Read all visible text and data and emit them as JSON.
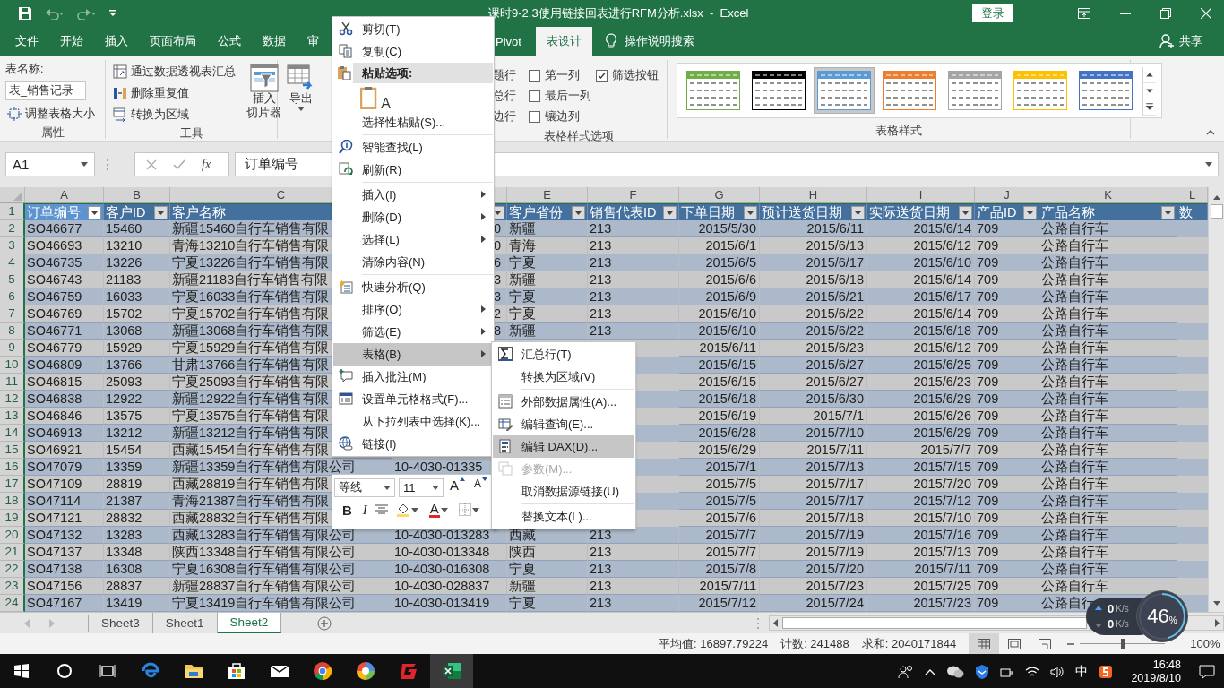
{
  "title_bar": {
    "title": "课时9-2.3使用链接回表进行RFM分析.xlsx  -  Excel",
    "sign_in": "登录"
  },
  "ribbon_tabs": [
    {
      "label": "文件",
      "selected": false
    },
    {
      "label": "开始",
      "selected": false
    },
    {
      "label": "插入",
      "selected": false
    },
    {
      "label": "页面布局",
      "selected": false
    },
    {
      "label": "公式",
      "selected": false
    },
    {
      "label": "数据",
      "selected": false
    },
    {
      "label": "审",
      "selected": false
    },
    {
      "label": "Pivot",
      "selected": false
    },
    {
      "label": "表设计",
      "selected": true
    }
  ],
  "tell_me": "操作说明搜索",
  "share": "共享",
  "ribbon": {
    "properties": {
      "name_label": "表名称:",
      "table_name": "表_销售记录",
      "resize": "调整表格大小",
      "label": "属性"
    },
    "tools": {
      "buttons": [
        "通过数据透视表汇总",
        "删除重复值",
        "转换为区域"
      ],
      "slicer": [
        "插入",
        "切片器"
      ],
      "label": "工具"
    },
    "export": "导出",
    "style_options": {
      "covered_labels": [
        "题行",
        "总行",
        "边行"
      ],
      "checkboxes": [
        {
          "label": "第一列",
          "checked": false
        },
        {
          "label": "最后一列",
          "checked": false
        },
        {
          "label": "镶边列",
          "checked": false
        },
        {
          "label": "筛选按钮",
          "checked": true
        }
      ],
      "label": "表格样式选项"
    },
    "table_styles": {
      "swatches": [
        {
          "color": "#70ad47",
          "selected": false
        },
        {
          "color": "#000000",
          "selected": false
        },
        {
          "color": "#5b9bd5",
          "selected": true
        },
        {
          "color": "#ed7d31",
          "selected": false
        },
        {
          "color": "#a5a5a5",
          "selected": false
        },
        {
          "color": "#ffc000",
          "selected": false
        },
        {
          "color": "#4472c4",
          "selected": false
        }
      ],
      "label": "表格样式"
    }
  },
  "formula_bar": {
    "name_box": "A1",
    "function_label": "fx",
    "formula": "订单编号"
  },
  "sheet": {
    "columns": [
      {
        "letter": "A",
        "header": "订单编号",
        "active": true
      },
      {
        "letter": "B",
        "header": "客户ID",
        "active": false
      },
      {
        "letter": "C",
        "header": "客户名称",
        "active": false
      },
      {
        "active": false
      },
      {
        "letter": "E",
        "header": "客户省份",
        "active": false
      },
      {
        "letter": "F",
        "header": "销售代表ID",
        "active": false
      },
      {
        "letter": "G",
        "header": "下单日期",
        "active": false
      },
      {
        "letter": "H",
        "header": "预计送货日期",
        "active": false
      },
      {
        "letter": "I",
        "header": "实际送货日期",
        "active": false
      },
      {
        "letter": "J",
        "header": "产品ID",
        "active": false
      },
      {
        "letter": "K",
        "header": "产品名称",
        "active": false
      },
      {
        "letter": "L",
        "header": "数",
        "active": false
      }
    ],
    "header_row": "1",
    "rows": [
      {
        "num": "2",
        "cells": {
          "A": "SO46677",
          "B": "15460",
          "C": "新疆15460自行车销售有限",
          "D_end": "0",
          "E": "新疆",
          "F": "213",
          "G": "2015/5/30",
          "H": "2015/6/11",
          "I": "2015/6/14",
          "J": "709",
          "K": "公路自行车"
        }
      },
      {
        "num": "3",
        "cells": {
          "A": "SO46693",
          "B": "13210",
          "C": "青海13210自行车销售有限",
          "D_end": "0",
          "E": "青海",
          "F": "213",
          "G": "2015/6/1",
          "H": "2015/6/13",
          "I": "2015/6/12",
          "J": "709",
          "K": "公路自行车"
        }
      },
      {
        "num": "4",
        "cells": {
          "A": "SO46735",
          "B": "13226",
          "C": "宁夏13226自行车销售有限",
          "D_end": "6",
          "E": "宁夏",
          "F": "213",
          "G": "2015/6/5",
          "H": "2015/6/17",
          "I": "2015/6/10",
          "J": "709",
          "K": "公路自行车"
        }
      },
      {
        "num": "5",
        "cells": {
          "A": "SO46743",
          "B": "21183",
          "C": "新疆21183自行车销售有限",
          "D_end": "3",
          "E": "新疆",
          "F": "213",
          "G": "2015/6/6",
          "H": "2015/6/18",
          "I": "2015/6/14",
          "J": "709",
          "K": "公路自行车"
        }
      },
      {
        "num": "6",
        "cells": {
          "A": "SO46759",
          "B": "16033",
          "C": "宁夏16033自行车销售有限",
          "D_end": "3",
          "E": "宁夏",
          "F": "213",
          "G": "2015/6/9",
          "H": "2015/6/21",
          "I": "2015/6/17",
          "J": "709",
          "K": "公路自行车"
        }
      },
      {
        "num": "7",
        "cells": {
          "A": "SO46769",
          "B": "15702",
          "C": "宁夏15702自行车销售有限",
          "D_end": "2",
          "E": "宁夏",
          "F": "213",
          "G": "2015/6/10",
          "H": "2015/6/22",
          "I": "2015/6/14",
          "J": "709",
          "K": "公路自行车"
        }
      },
      {
        "num": "8",
        "cells": {
          "A": "SO46771",
          "B": "13068",
          "C": "新疆13068自行车销售有限",
          "D_end": "8",
          "E": "新疆",
          "F": "213",
          "G": "2015/6/10",
          "H": "2015/6/22",
          "I": "2015/6/18",
          "J": "709",
          "K": "公路自行车"
        }
      },
      {
        "num": "9",
        "cells": {
          "A": "SO46779",
          "B": "15929",
          "C": "宁夏15929自行车销售有限",
          "G": "2015/6/11",
          "H": "2015/6/23",
          "I": "2015/6/12",
          "J": "709",
          "K": "公路自行车"
        }
      },
      {
        "num": "10",
        "cells": {
          "A": "SO46809",
          "B": "13766",
          "C": "甘肃13766自行车销售有限",
          "G": "2015/6/15",
          "H": "2015/6/27",
          "I": "2015/6/25",
          "J": "709",
          "K": "公路自行车"
        }
      },
      {
        "num": "11",
        "cells": {
          "A": "SO46815",
          "B": "25093",
          "C": "宁夏25093自行车销售有限",
          "G": "2015/6/15",
          "H": "2015/6/27",
          "I": "2015/6/23",
          "J": "709",
          "K": "公路自行车"
        }
      },
      {
        "num": "12",
        "cells": {
          "A": "SO46838",
          "B": "12922",
          "C": "新疆12922自行车销售有限",
          "G": "2015/6/18",
          "H": "2015/6/30",
          "I": "2015/6/29",
          "J": "709",
          "K": "公路自行车"
        }
      },
      {
        "num": "13",
        "cells": {
          "A": "SO46846",
          "B": "13575",
          "C": "宁夏13575自行车销售有限",
          "G": "2015/6/19",
          "H": "2015/7/1",
          "I": "2015/6/26",
          "J": "709",
          "K": "公路自行车"
        }
      },
      {
        "num": "14",
        "cells": {
          "A": "SO46913",
          "B": "13212",
          "C": "新疆13212自行车销售有限",
          "G": "2015/6/28",
          "H": "2015/7/10",
          "I": "2015/6/29",
          "J": "709",
          "K": "公路自行车"
        }
      },
      {
        "num": "15",
        "cells": {
          "A": "SO46921",
          "B": "15454",
          "C": "西藏15454自行车销售有限",
          "G": "2015/6/29",
          "H": "2015/7/11",
          "I": "2015/7/7",
          "J": "709",
          "K": "公路自行车"
        }
      },
      {
        "num": "16",
        "cells": {
          "A": "SO47079",
          "B": "13359",
          "C": "新疆13359自行车销售有限公司",
          "D": "10-4030-01335",
          "G": "2015/7/1",
          "H": "2015/7/13",
          "I": "2015/7/15",
          "J": "709",
          "K": "公路自行车"
        }
      },
      {
        "num": "17",
        "cells": {
          "A": "SO47109",
          "B": "28819",
          "C": "西藏28819自行车销售有限",
          "G": "2015/7/5",
          "H": "2015/7/17",
          "I": "2015/7/20",
          "J": "709",
          "K": "公路自行车"
        }
      },
      {
        "num": "18",
        "cells": {
          "A": "SO47114",
          "B": "21387",
          "C": "青海21387自行车销售有限",
          "G": "2015/7/5",
          "H": "2015/7/17",
          "I": "2015/7/12",
          "J": "709",
          "K": "公路自行车"
        }
      },
      {
        "num": "19",
        "cells": {
          "A": "SO47121",
          "B": "28832",
          "C": "西藏28832自行车销售有限",
          "G": "2015/7/6",
          "H": "2015/7/18",
          "I": "2015/7/10",
          "J": "709",
          "K": "公路自行车"
        }
      },
      {
        "num": "20",
        "cells": {
          "A": "SO47132",
          "B": "13283",
          "C": "西藏13283自行车销售有限公司",
          "D": "10-4030-013283",
          "E": "西藏",
          "F": "213",
          "G": "2015/7/7",
          "H": "2015/7/19",
          "I": "2015/7/16",
          "J": "709",
          "K": "公路自行车"
        }
      },
      {
        "num": "21",
        "cells": {
          "A": "SO47137",
          "B": "13348",
          "C": "陕西13348自行车销售有限公司",
          "D": "10-4030-013348",
          "E": "陕西",
          "F": "213",
          "G": "2015/7/7",
          "H": "2015/7/19",
          "I": "2015/7/13",
          "J": "709",
          "K": "公路自行车"
        }
      },
      {
        "num": "22",
        "cells": {
          "A": "SO47138",
          "B": "16308",
          "C": "宁夏16308自行车销售有限公司",
          "D": "10-4030-016308",
          "E": "宁夏",
          "F": "213",
          "G": "2015/7/8",
          "H": "2015/7/20",
          "I": "2015/7/11",
          "J": "709",
          "K": "公路自行车"
        }
      },
      {
        "num": "23",
        "cells": {
          "A": "SO47156",
          "B": "28837",
          "C": "新疆28837自行车销售有限公司",
          "D": "10-4030-028837",
          "E": "新疆",
          "F": "213",
          "G": "2015/7/11",
          "H": "2015/7/23",
          "I": "2015/7/25",
          "J": "709",
          "K": "公路自行车"
        }
      },
      {
        "num": "24",
        "cells": {
          "A": "SO47167",
          "B": "13419",
          "C": "宁夏13419自行车销售有限公司",
          "D": "10-4030-013419",
          "E": "宁夏",
          "F": "213",
          "G": "2015/7/12",
          "H": "2015/7/24",
          "I": "2015/7/23",
          "J": "709",
          "K": "公路自行"
        }
      }
    ]
  },
  "context_menu": {
    "items": [
      {
        "kind": "item",
        "label": "剪切(T)",
        "submenu": false,
        "selected": false
      },
      {
        "kind": "item",
        "label": "复制(C)",
        "submenu": false,
        "selected": false
      },
      {
        "kind": "header",
        "label": "粘贴选项:"
      },
      {
        "kind": "paste",
        "glyph": "A"
      },
      {
        "kind": "item",
        "label": "选择性粘贴(S)...",
        "submenu": false,
        "selected": false
      },
      {
        "kind": "separator"
      },
      {
        "kind": "item",
        "label": "智能查找(L)",
        "submenu": false,
        "selected": false
      },
      {
        "kind": "item",
        "label": "刷新(R)",
        "submenu": false,
        "selected": false
      },
      {
        "kind": "separator"
      },
      {
        "kind": "item",
        "label": "插入(I)",
        "submenu": true,
        "selected": false
      },
      {
        "kind": "item",
        "label": "删除(D)",
        "submenu": true,
        "selected": false
      },
      {
        "kind": "item",
        "label": "选择(L)",
        "submenu": true,
        "selected": false
      },
      {
        "kind": "item",
        "label": "清除内容(N)",
        "submenu": false,
        "selected": false
      },
      {
        "kind": "separator"
      },
      {
        "kind": "item",
        "label": "快速分析(Q)",
        "submenu": false,
        "selected": false
      },
      {
        "kind": "item",
        "label": "排序(O)",
        "submenu": true,
        "selected": false
      },
      {
        "kind": "item",
        "label": "筛选(E)",
        "submenu": true,
        "selected": false
      },
      {
        "kind": "item",
        "label": "表格(B)",
        "submenu": true,
        "selected": true
      },
      {
        "kind": "item",
        "label": "插入批注(M)",
        "submenu": false,
        "selected": false
      },
      {
        "kind": "item",
        "label": "设置单元格格式(F)...",
        "submenu": false,
        "selected": false
      },
      {
        "kind": "item",
        "label": "从下拉列表中选择(K)...",
        "submenu": false,
        "selected": false
      },
      {
        "kind": "item",
        "label": "链接(I)",
        "submenu": false,
        "selected": false
      }
    ]
  },
  "submenu": {
    "items": [
      {
        "kind": "item",
        "label": "汇总行(T)",
        "disabled": false,
        "selected": false
      },
      {
        "kind": "item",
        "label": "转换为区域(V)",
        "disabled": false,
        "selected": false
      },
      {
        "kind": "separator"
      },
      {
        "kind": "item",
        "label": "外部数据属性(A)...",
        "disabled": false,
        "selected": false
      },
      {
        "kind": "item",
        "label": "编辑查询(E)...",
        "disabled": false,
        "selected": false
      },
      {
        "kind": "item",
        "label": "编辑 DAX(D)...",
        "disabled": false,
        "selected": true
      },
      {
        "kind": "item",
        "label": "参数(M)...",
        "disabled": true,
        "selected": false
      },
      {
        "kind": "item",
        "label": "取消数据源链接(U)",
        "disabled": false,
        "selected": false
      },
      {
        "kind": "separator"
      },
      {
        "kind": "item",
        "label": "替换文本(L)...",
        "disabled": false,
        "selected": false
      }
    ]
  },
  "mini_toolbar": {
    "font": "等线",
    "size": "11",
    "grow": "A",
    "shrink": "A",
    "bold": "B",
    "italic": "I",
    "font_color": "A"
  },
  "sheet_tabs": [
    {
      "label": "Sheet3",
      "selected": false
    },
    {
      "label": "Sheet1",
      "selected": false
    },
    {
      "label": "Sheet2",
      "selected": true
    }
  ],
  "status_bar": {
    "average": "平均值: 16897.79224",
    "count": "计数: 241488",
    "sum": "求和: 2040171844",
    "views": [
      {
        "kind": "normal",
        "selected": true
      },
      {
        "kind": "layout",
        "selected": false
      },
      {
        "kind": "break",
        "selected": false
      }
    ],
    "zoom": {
      "level": 0.5,
      "reading": "100%"
    }
  },
  "speed_widget": {
    "upload": "0",
    "upload_unit": "K/s",
    "download": "0",
    "download_unit": "K/s",
    "level": 0.46,
    "reading": "46",
    "percent": "%"
  },
  "taskbar": {
    "apps": [
      {
        "kind": "edge",
        "active": false
      },
      {
        "kind": "files",
        "active": false
      },
      {
        "kind": "store",
        "active": false
      },
      {
        "kind": "mail",
        "active": false
      },
      {
        "kind": "chrome",
        "active": false
      },
      {
        "kind": "colorball",
        "active": false
      },
      {
        "kind": "redapp",
        "active": false
      },
      {
        "kind": "excel",
        "active": true
      }
    ],
    "ime": "中",
    "time": "16:48",
    "date": "2019/8/10"
  }
}
